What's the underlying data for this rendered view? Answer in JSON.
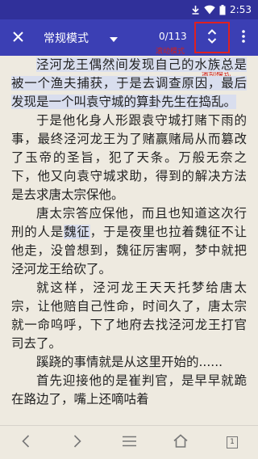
{
  "status_bar": {
    "time": "2:53",
    "icons": [
      "download-icon",
      "wifi-icon",
      "battery-icon"
    ]
  },
  "toolbar": {
    "mode_label": "常规模式",
    "page_counter": "0/113",
    "icons": [
      "close-icon",
      "caret-down-icon",
      "scroll-toggle-icon",
      "more-vert-icon"
    ]
  },
  "annotations": {
    "scroll_mode_1": "滚动模式",
    "scroll_mode_2": "滚动模式"
  },
  "content": {
    "paragraphs": [
      {
        "segments": [
          {
            "text": "泾河龙王偶然间发现自己的水族总是被一个渔夫捕获，于是去调查原因，最后发现是一个叫袁守城的算卦先生在捣乱。",
            "highlight": true
          }
        ]
      },
      {
        "segments": [
          {
            "text": "于是他化身人形跟袁守城打赌下雨的事，最终泾河龙王为了赌赢赌局从而篡改了玉帝的圣旨，犯了天条。万般无奈之下，他又向袁守城求助，得到的解决方法是去求唐太宗保他。",
            "highlight": false
          }
        ]
      },
      {
        "segments": [
          {
            "text": "唐太宗答应保他，而且也知道这次行刑的人是",
            "highlight": false
          },
          {
            "text": "魏征",
            "highlight": true
          },
          {
            "text": "，于是夜里也拉着魏征不让他走，没曾想到，魏征厉害啊，梦中就把泾河龙王给砍了。",
            "highlight": false
          }
        ]
      },
      {
        "segments": [
          {
            "text": "就这样，泾河龙王天天托梦给唐太宗，让他赔自己性命，时间久了，唐太宗就一命呜呼，下了地府去找泾河龙王打官司去了。",
            "highlight": false
          }
        ]
      },
      {
        "segments": [
          {
            "text": "蹊跷的事情就是从这里开始的......",
            "highlight": false
          }
        ]
      },
      {
        "segments": [
          {
            "text": "首先迎接他的是崔判官，是早早就跪在路边了，嘴上还嘀咕着",
            "highlight": false
          }
        ]
      }
    ]
  },
  "bottom_bar": {
    "page_box_label": "1",
    "icons": [
      "back-arrow-icon",
      "forward-arrow-icon",
      "menu-icon",
      "home-icon",
      "page-icon"
    ]
  }
}
